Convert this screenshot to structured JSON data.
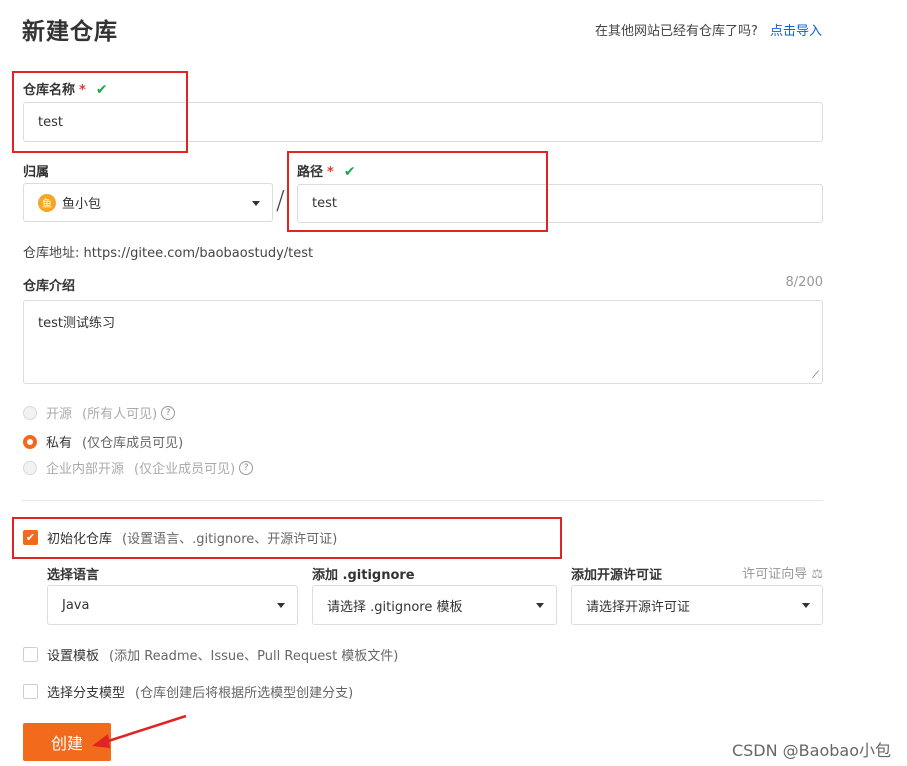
{
  "page": {
    "title": "新建仓库"
  },
  "import": {
    "hint": "在其他网站已经有仓库了吗?",
    "link": "点击导入"
  },
  "repo_name": {
    "label": "仓库名称",
    "required": "*",
    "value": "test",
    "valid_mark": "✔"
  },
  "owner": {
    "label": "归属",
    "value": "鱼小包",
    "avatar_char": "鱼"
  },
  "separator": "/",
  "path": {
    "label": "路径",
    "required": "*",
    "value": "test",
    "valid_mark": "✔"
  },
  "repo_url": {
    "label": "仓库地址:",
    "value": "https://gitee.com/baobaostudy/test"
  },
  "description": {
    "label": "仓库介绍",
    "counter": "8/200",
    "value": "test测试练习"
  },
  "visibility": {
    "options": [
      {
        "label": "开源",
        "note": "(所有人可见)",
        "selected": false,
        "disabled": true,
        "help": "?"
      },
      {
        "label": "私有",
        "note": "(仅仓库成员可见)",
        "selected": true,
        "disabled": false
      },
      {
        "label": "企业内部开源",
        "note": "(仅企业成员可见)",
        "selected": false,
        "disabled": true,
        "help": "?"
      }
    ]
  },
  "init_repo": {
    "label": "初始化仓库",
    "note": "(设置语言、.gitignore、开源许可证)",
    "checked": true,
    "check_mark": "✔"
  },
  "language": {
    "label": "选择语言",
    "value": "Java"
  },
  "gitignore": {
    "label": "添加 .gitignore",
    "value": "请选择 .gitignore 模板"
  },
  "license": {
    "label": "添加开源许可证",
    "guide": "许可证向导",
    "guide_icon": "⚖",
    "value": "请选择开源许可证"
  },
  "template": {
    "label": "设置模板",
    "note": "(添加 Readme、Issue、Pull Request 模板文件)",
    "checked": false
  },
  "branch_model": {
    "label": "选择分支模型",
    "note": "(仓库创建后将根据所选模型创建分支)",
    "checked": false
  },
  "create_button": {
    "label": "创建"
  },
  "watermark": {
    "text": "CSDN @Baobao小包"
  },
  "colors": {
    "accent": "#f26b1d",
    "annotation": "#e02424",
    "link": "#0366d6",
    "valid": "#21a34b"
  }
}
